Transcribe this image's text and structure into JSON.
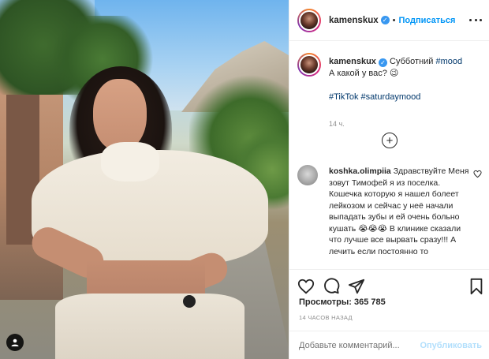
{
  "post": {
    "username": "kamenskux",
    "verified_symbol": "✓",
    "separator": "•",
    "follow_label": "Подписаться",
    "caption_text_1": "Субботний",
    "caption_tag_1": "#mood",
    "caption_text_2": "А какой у вас? 😉",
    "caption_tags": "#TikTok #saturdaymood",
    "caption_time": "14 ч.",
    "load_more_symbol": "+"
  },
  "comment": {
    "username": "koshka.olimpiia",
    "text": "Здравствуйте Меня зовут Тимофей я из поселка. Кошечка которую я нашел болеет лейкозом и сейчас у неё начали выпадать зубы и ей очень больно кушать 😭😭😭 В клинике сказали что лучше все вырвать сразу!!! А лечить если постоянно то"
  },
  "stats": {
    "views_label": "Просмотры:",
    "views_count": "365 785",
    "time_ago": "14 ЧАСОВ НАЗАД"
  },
  "composer": {
    "placeholder": "Добавьте комментарий...",
    "publish_label": "Опубликовать"
  },
  "icons": {
    "more": "more-options-icon",
    "heart": "heart-icon",
    "comment": "comment-icon",
    "share": "share-icon",
    "save": "bookmark-icon",
    "load_more": "plus-circle-icon",
    "user_tag": "user-tag-icon"
  },
  "colors": {
    "accent": "#0095f6",
    "verified": "#3897f0",
    "hashtag": "#00376b",
    "muted": "#8e8e8e",
    "publish_disabled": "#b2dffc"
  }
}
